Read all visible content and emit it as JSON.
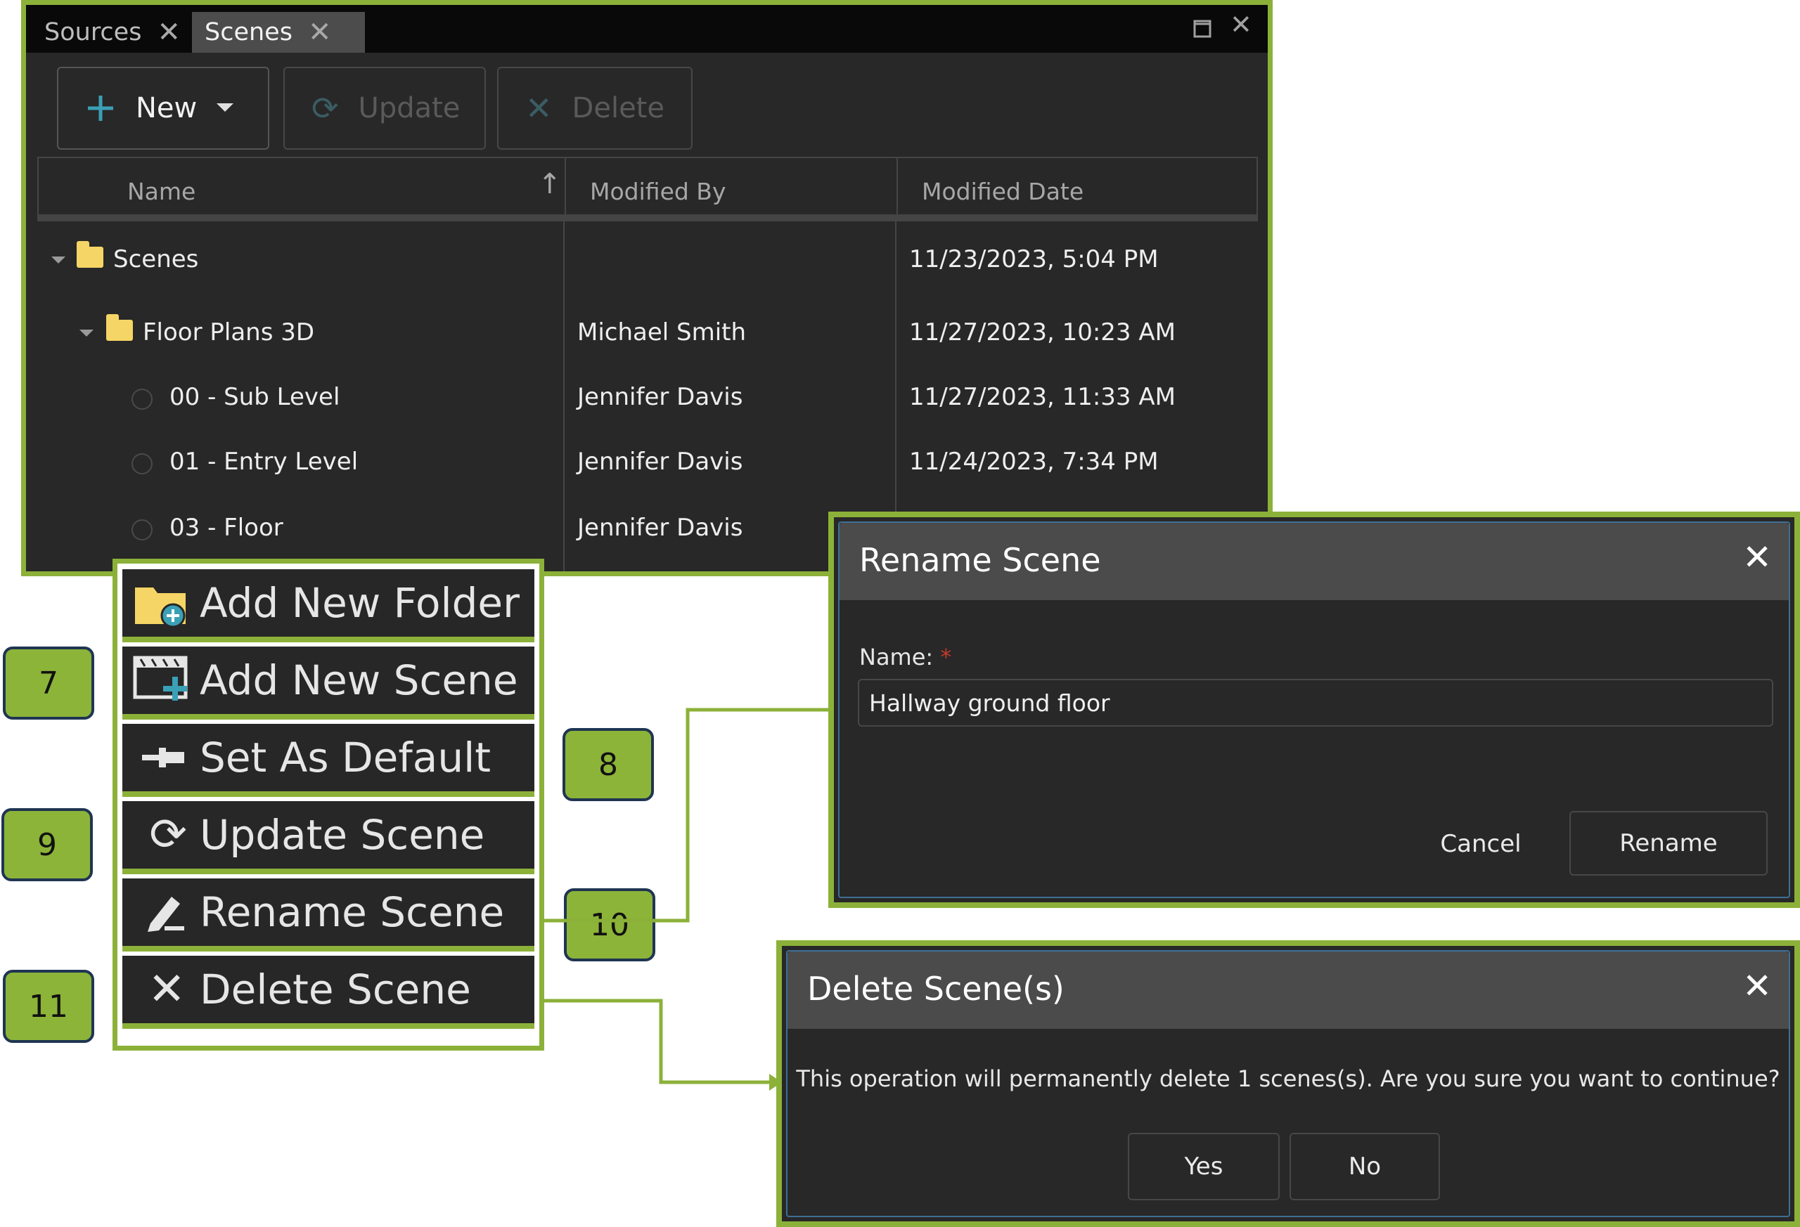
{
  "tabs": [
    {
      "label": "Sources",
      "active": false
    },
    {
      "label": "Scenes",
      "active": true
    }
  ],
  "toolbar": {
    "new_label": "New",
    "update_label": "Update",
    "delete_label": "Delete"
  },
  "columns": {
    "name": "Name",
    "modified_by": "Modified By",
    "modified_date": "Modified Date"
  },
  "rows": [
    {
      "name": "Scenes",
      "type": "folder",
      "level": 0,
      "modified_by": "",
      "modified_date": "11/23/2023, 5:04 PM"
    },
    {
      "name": "Floor Plans 3D",
      "type": "folder",
      "level": 1,
      "modified_by": "Michael Smith",
      "modified_date": "11/27/2023, 10:23 AM"
    },
    {
      "name": "00 - Sub Level",
      "type": "scene",
      "level": 2,
      "modified_by": "Jennifer Davis",
      "modified_date": "11/27/2023, 11:33 AM"
    },
    {
      "name": "01 - Entry Level",
      "type": "scene",
      "level": 2,
      "modified_by": "Jennifer Davis",
      "modified_date": "11/24/2023, 7:34 PM"
    },
    {
      "name": "03 - Floor",
      "type": "scene",
      "level": 2,
      "modified_by": "Jennifer Davis",
      "modified_date": ""
    }
  ],
  "context_menu": [
    {
      "label": "Add New Folder",
      "icon": "add-folder-icon"
    },
    {
      "label": "Add New Scene",
      "icon": "add-scene-icon"
    },
    {
      "label": "Set As Default",
      "icon": "pin-icon"
    },
    {
      "label": "Update Scene",
      "icon": "refresh-icon"
    },
    {
      "label": "Rename Scene",
      "icon": "pencil-icon"
    },
    {
      "label": "Delete Scene",
      "icon": "close-icon"
    }
  ],
  "callouts": [
    "7",
    "8",
    "9",
    "10",
    "11"
  ],
  "rename_dialog": {
    "title": "Rename Scene",
    "name_label": "Name:",
    "required_mark": "*",
    "name_value": "Hallway ground floor",
    "cancel_label": "Cancel",
    "rename_label": "Rename"
  },
  "delete_dialog": {
    "title": "Delete Scene(s)",
    "message": "This operation will permanently delete 1 scenes(s). Are you sure you want to continue?",
    "yes_label": "Yes",
    "no_label": "No"
  },
  "colors": {
    "highlight": "#8cb139",
    "panel_bg": "#282828",
    "accent_teal": "#3aa0b6",
    "folder_yellow": "#f5d565"
  }
}
